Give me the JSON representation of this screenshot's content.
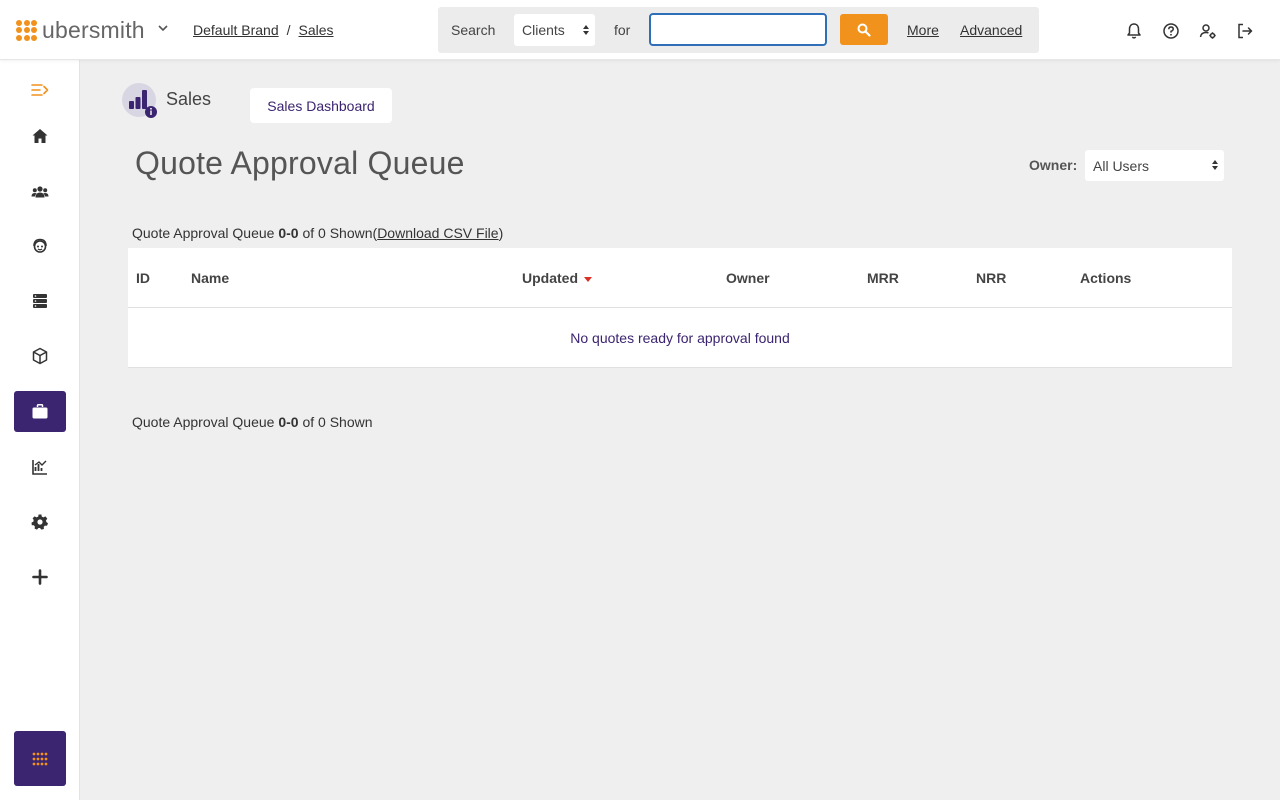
{
  "brand": {
    "name": "ubersmith",
    "dot_colors": [
      "#f0921c",
      "#f0921c",
      "#f0921c",
      "#f0921c",
      "#f0921c",
      "#f0921c",
      "#f0921c",
      "#f0921c",
      "#f0921c"
    ]
  },
  "breadcrumb": {
    "items": [
      "Default Brand",
      "Sales"
    ],
    "separator": "/"
  },
  "search": {
    "label": "Search",
    "scope": "Clients",
    "for_label": "for",
    "value": "",
    "more_label": "More",
    "advanced_label": "Advanced"
  },
  "top_icons": [
    "bell-icon",
    "help-icon",
    "user-settings-icon",
    "logout-icon"
  ],
  "sidebar": {
    "items": [
      {
        "icon": "collapse-menu-icon",
        "active": false
      },
      {
        "icon": "home-icon",
        "active": false
      },
      {
        "icon": "clients-icon",
        "active": false
      },
      {
        "icon": "support-icon",
        "active": false
      },
      {
        "icon": "devices-icon",
        "active": false
      },
      {
        "icon": "packages-icon",
        "active": false
      },
      {
        "icon": "sales-briefcase-icon",
        "active": true
      },
      {
        "icon": "reports-icon",
        "active": false
      },
      {
        "icon": "settings-icon",
        "active": false
      },
      {
        "icon": "add-icon",
        "active": false
      }
    ],
    "apps_icon": "apps-grid-icon"
  },
  "section": {
    "name": "Sales",
    "dashboard_button": "Sales Dashboard"
  },
  "page": {
    "title": "Quote Approval Queue",
    "owner_label": "Owner:",
    "owner_value": "All Users"
  },
  "summary_top": {
    "prefix": "Quote Approval Queue",
    "range": "0-0",
    "suffix": "of 0 Shown",
    "open_paren": "(",
    "csv_link": "Download CSV File",
    "close_paren": ")"
  },
  "table": {
    "columns": [
      "ID",
      "Name",
      "Updated",
      "Owner",
      "MRR",
      "NRR",
      "Actions"
    ],
    "sorted_column": "Updated",
    "empty_message": "No quotes ready for approval found"
  },
  "summary_bottom": {
    "prefix": "Quote Approval Queue",
    "range": "0-0",
    "suffix": "of 0 Shown"
  },
  "colors": {
    "accent": "#f0921c",
    "primary": "#3b2470",
    "sort_arrow": "#d93025"
  }
}
